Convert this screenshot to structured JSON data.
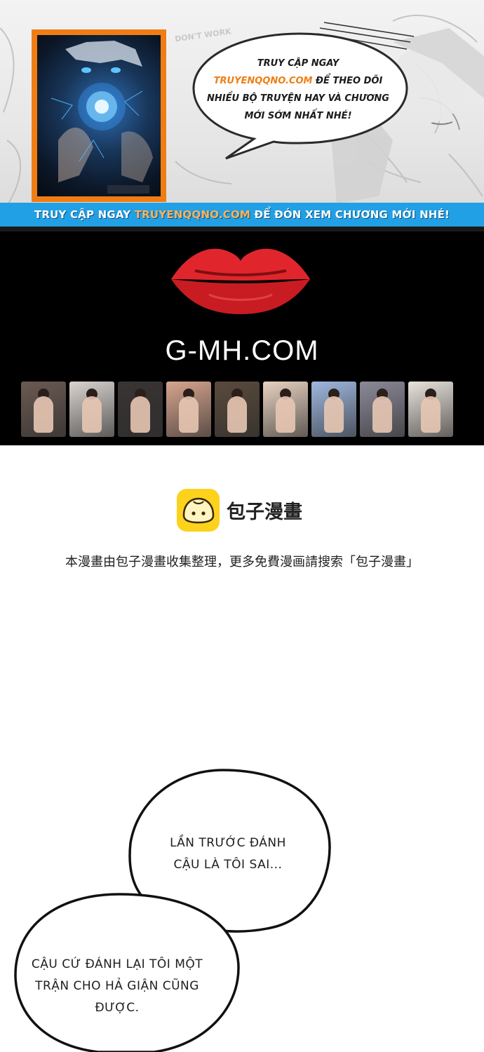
{
  "promo": {
    "bubble_line_1": "TRUY CẬP NGAY",
    "bubble_link": "TRUYENQQNO.COM",
    "bubble_line_2a": " ĐỂ THEO DÕI",
    "bubble_line_3": "NHIỀU BỘ TRUYỆN HAY VÀ CHƯƠNG",
    "bubble_line_4": "MỚI SỚM NHẤT NHÉ!",
    "strip_prefix": "TRUY CẬP NGAY ",
    "strip_link": "TRUYENQQNO.COM",
    "strip_suffix": " ĐỂ ĐÓN XEM CHƯƠNG MỚI NHÉ!",
    "bg_text": "DON'T WORK"
  },
  "ad": {
    "title": "G-MH.COM",
    "lips_color": "#e0262c",
    "thumbnails": [
      {
        "tone": "#6b5a52"
      },
      {
        "tone": "#d9d4d0"
      },
      {
        "tone": "#3a3434"
      },
      {
        "tone": "#d7a58f"
      },
      {
        "tone": "#5a4a3c"
      },
      {
        "tone": "#e8d2c0"
      },
      {
        "tone": "#9fb8e0"
      },
      {
        "tone": "#8c8a99"
      },
      {
        "tone": "#e9e3dc"
      }
    ]
  },
  "baozi": {
    "name": "包子漫畫",
    "note": "本漫畫由包子漫畫收集整理，更多免費漫画請搜索「包子漫畫」",
    "logo_color": "#fcd21c"
  },
  "dialogue": {
    "bubble_1_line_1": "LẦN TRƯỚC ĐÁNH",
    "bubble_1_line_2": "CẬU LÀ TÔI SAI...",
    "bubble_2_line_1": "CẬU CỨ ĐÁNH LẠI TÔI MỘT",
    "bubble_2_line_2": "TRẬN CHO HẢ GIẬN CŨNG",
    "bubble_2_line_3": "ĐƯỢC."
  }
}
